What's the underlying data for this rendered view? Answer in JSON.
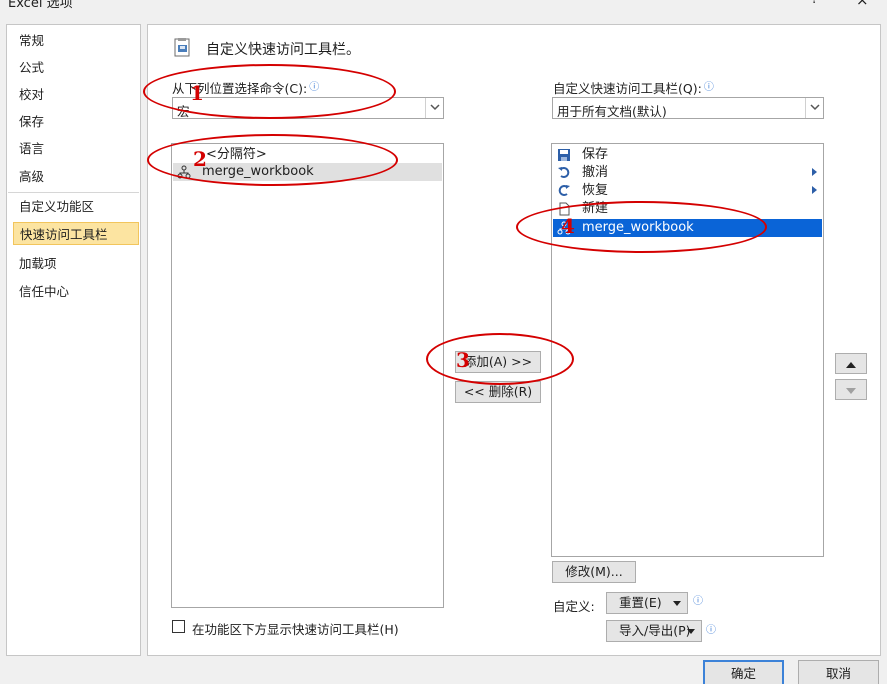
{
  "window": {
    "title": "Excel 选项",
    "help": "?",
    "close": "×"
  },
  "sidebar": {
    "items": [
      {
        "label": "常规"
      },
      {
        "label": "公式"
      },
      {
        "label": "校对"
      },
      {
        "label": "保存"
      },
      {
        "label": "语言"
      },
      {
        "label": "高级"
      },
      {
        "label": "自定义功能区"
      },
      {
        "label": "快速访问工具栏",
        "selected": true
      },
      {
        "label": "加载项"
      },
      {
        "label": "信任中心"
      }
    ]
  },
  "main": {
    "header": "自定义快速访问工具栏。",
    "choose_label": "从下列位置选择命令(C):",
    "choose_value": "宏",
    "qat_label": "自定义快速访问工具栏(Q):",
    "qat_value": "用于所有文档(默认)",
    "left_list": [
      {
        "label": "<分隔符>",
        "icon": "separator-icon"
      },
      {
        "label": "merge_workbook",
        "icon": "macro-icon"
      }
    ],
    "right_list": [
      {
        "label": "保存",
        "icon": "save-icon"
      },
      {
        "label": "撤消",
        "icon": "undo-icon"
      },
      {
        "label": "恢复",
        "icon": "redo-icon"
      },
      {
        "label": "新建",
        "icon": "new-document-icon"
      },
      {
        "label": "merge_workbook",
        "icon": "macro-icon"
      }
    ],
    "add_button": "添加(A) >>",
    "remove_button": "<< 删除(R)",
    "modify_button": "修改(M)...",
    "customize_label": "自定义:",
    "reset_button": "重置(E)",
    "import_export_button": "导入/导出(P)",
    "show_below_ribbon": "在功能区下方显示快速访问工具栏(H)",
    "info_glyph": "ⓘ"
  },
  "footer": {
    "ok": "确定",
    "cancel": "取消"
  },
  "annotations": [
    "1",
    "2",
    "3",
    "4"
  ],
  "colors": {
    "selection": "#0a64d7",
    "annotation": "#d40000",
    "nav_selected": "#fce4a1"
  }
}
